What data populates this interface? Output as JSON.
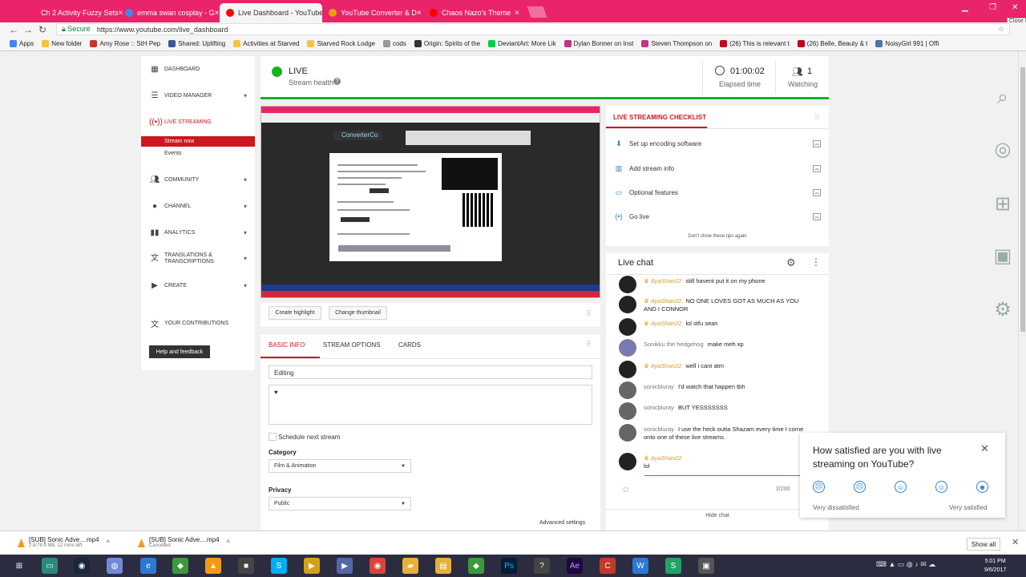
{
  "browser": {
    "tabs": [
      {
        "label": "Ch 2 Activity Fuzzy Sets",
        "color": "#e9246b"
      },
      {
        "label": "emma swan cosplay - G",
        "color": "#4285f4"
      },
      {
        "label": "Live Dashboard - YouTube",
        "color": "#ff0000"
      },
      {
        "label": "YouTube Converter & D",
        "color": "#f29a14"
      },
      {
        "label": "Chaos Nazo's Theme",
        "color": "#ff0000"
      }
    ],
    "close_glyph": "×",
    "url_secure": "Secure",
    "url": "https://www.youtube.com/live_dashboard",
    "close_tooltip": "Close",
    "bookmarks": [
      {
        "label": "Apps",
        "color": "#4285f4"
      },
      {
        "label": "New folder",
        "color": "#f4c542"
      },
      {
        "label": "Amy Rose :: StH Pep",
        "color": "#c33"
      },
      {
        "label": "Shared: Uplifting",
        "color": "#3b5998"
      },
      {
        "label": "Activities at Starved",
        "color": "#f4c542"
      },
      {
        "label": "Starved Rock Lodge",
        "color": "#f4c542"
      },
      {
        "label": "cods",
        "color": "#999"
      },
      {
        "label": "Origin: Spirits of the",
        "color": "#333"
      },
      {
        "label": "DeviantArt: More Lik",
        "color": "#05cc47"
      },
      {
        "label": "Dylan Bonner on Inst",
        "color": "#c13584"
      },
      {
        "label": "Steven Thompson on",
        "color": "#c13584"
      },
      {
        "label": "(26) This is relevant t",
        "color": "#bd081c"
      },
      {
        "label": "(26) Belle, Beauty & t",
        "color": "#bd081c"
      },
      {
        "label": "NoisyGirl 991 | Offi",
        "color": "#4a76a8"
      }
    ]
  },
  "sidebar": {
    "items": [
      {
        "label": "Dashboard",
        "icon": "dashboard-icon"
      },
      {
        "label": "Video Manager",
        "icon": "video-manager-icon"
      },
      {
        "label": "Live Streaming",
        "icon": "live-icon"
      },
      {
        "label": "Community",
        "icon": "community-icon"
      },
      {
        "label": "Channel",
        "icon": "channel-icon"
      },
      {
        "label": "Analytics",
        "icon": "analytics-icon"
      },
      {
        "label": "Translations & Transcriptions",
        "icon": "translate-icon"
      },
      {
        "label": "Create",
        "icon": "create-icon"
      },
      {
        "label": "Your Contributions",
        "icon": "contributions-icon"
      }
    ],
    "stream_now": "Stream now",
    "events": "Events",
    "help": "Help and feedback"
  },
  "status": {
    "live": "LIVE",
    "health": "Stream health",
    "elapsed": "01:00:02",
    "elapsed_label": "Elapsed time",
    "watching": "1",
    "watching_label": "Watching",
    "live_color": "#16b320"
  },
  "video_preview": {
    "logo_text": "ConverterCo"
  },
  "actions": {
    "highlight": "Create highlight",
    "thumbnail": "Change thumbnail"
  },
  "info_tabs": [
    "BASIC INFO",
    "STREAM OPTIONS",
    "CARDS"
  ],
  "form": {
    "title": "Editing",
    "description": "♥",
    "schedule": "Schedule next stream",
    "category_label": "Category",
    "category": "Film & Animation",
    "privacy_label": "Privacy",
    "privacy": "Public",
    "advanced": "Advanced settings"
  },
  "checklist": {
    "title": "LIVE STREAMING CHECKLIST",
    "items": [
      {
        "label": "Set up encoding software",
        "icon": "download-icon"
      },
      {
        "label": "Add stream info",
        "icon": "info-icon"
      },
      {
        "label": "Optional features",
        "icon": "card-icon"
      },
      {
        "label": "Go live",
        "icon": "broadcast-icon"
      }
    ],
    "dont_show": "Don't show these tips again"
  },
  "chat": {
    "title": "Live chat",
    "messages": [
      {
        "author": "AyaShan22",
        "moderator": true,
        "text": "still havent put it on my phone"
      },
      {
        "author": "AyaShan22",
        "moderator": true,
        "text": "NO ONE LOVES GOT AS MUCH AS YOU AND I CONNOR"
      },
      {
        "author": "AyaShan22",
        "moderator": true,
        "text": "lol stfu sean"
      },
      {
        "author": "Sonikku the hedgehog",
        "moderator": false,
        "text": "make meh xp"
      },
      {
        "author": "AyaShan22",
        "moderator": true,
        "text": "well i cant atm"
      },
      {
        "author": "sonicbluray",
        "moderator": false,
        "text": "I'd watch that happen tbh"
      },
      {
        "author": "sonicbluray",
        "moderator": false,
        "text": "BUT YESSSSSSS"
      },
      {
        "author": "sonicbluray",
        "moderator": false,
        "text": "I use the heck outta Shazam every time I come onto one of these live streams."
      }
    ],
    "input_author": "AyaShan22",
    "input_value": "lol",
    "counter": "2/200",
    "hide": "Hide chat"
  },
  "survey": {
    "question": "How satisfied are you with live streaming on YouTube?",
    "low": "Very dissatisfied",
    "high": "Very satisfied"
  },
  "downloads": [
    {
      "name": "[SUB] Sonic Adve....mp4",
      "status": "2.8/78.9 MB, 12 mins left"
    },
    {
      "name": "[SUB] Sonic Adve....mp4",
      "status": "Cancelled"
    }
  ],
  "downloads_show_all": "Show all",
  "taskbar": {
    "time": "5:01 PM",
    "date": "9/6/2017"
  }
}
